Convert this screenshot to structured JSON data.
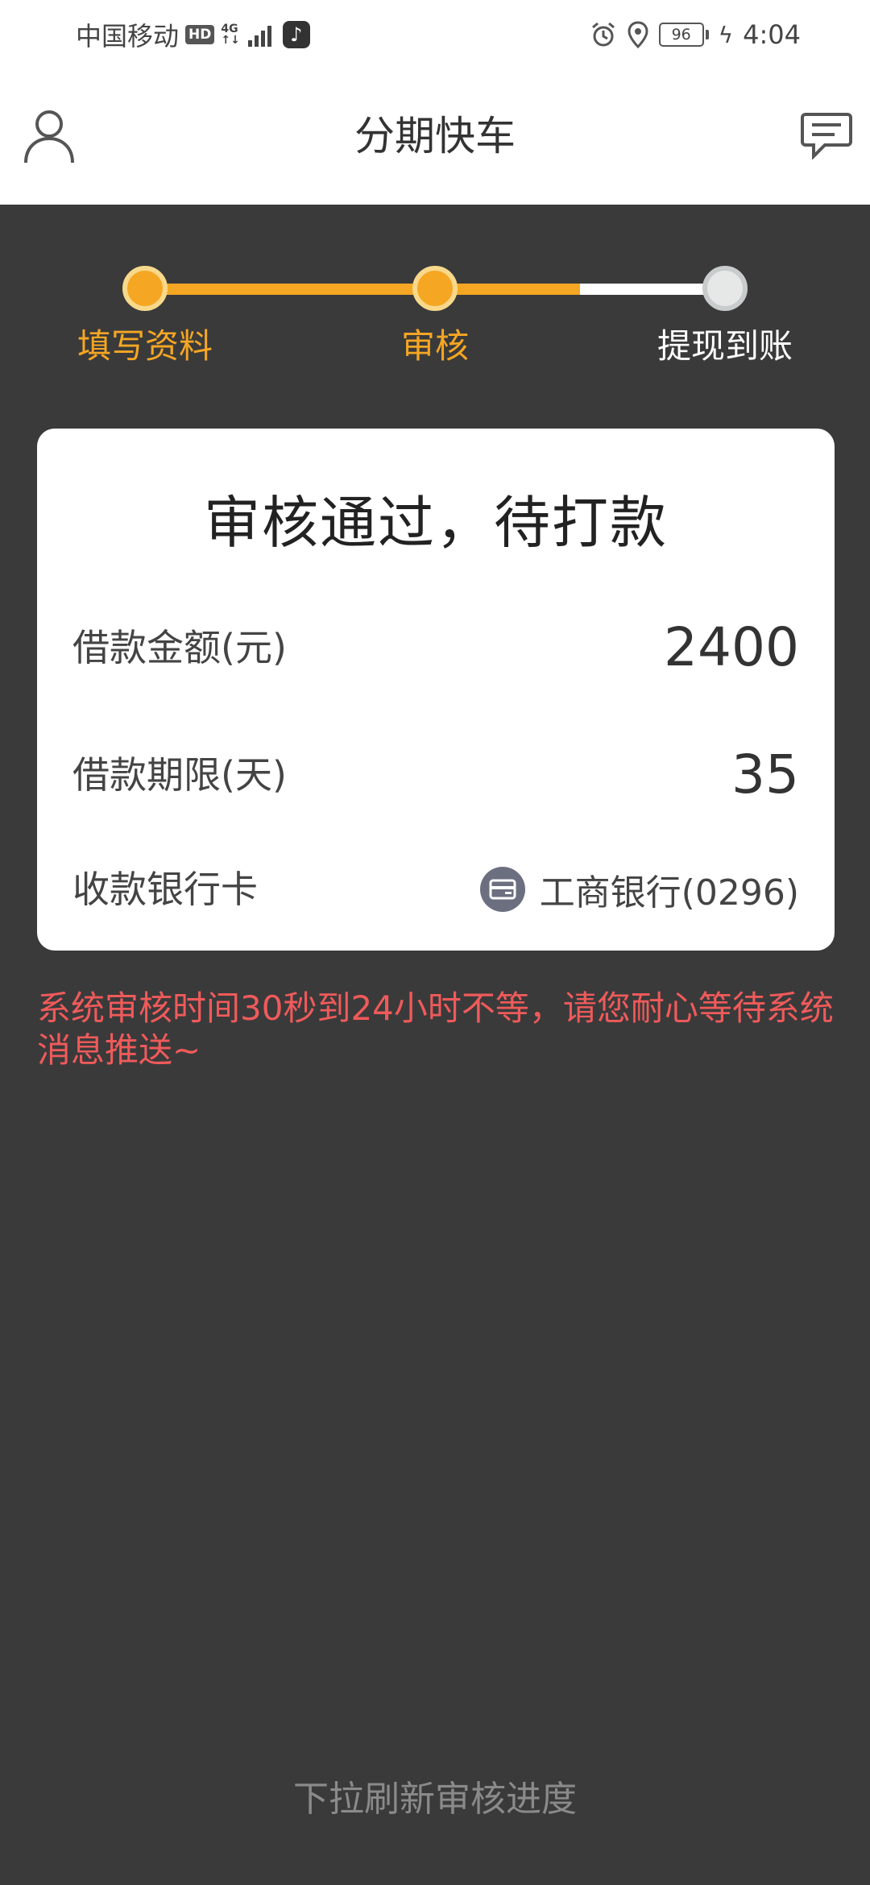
{
  "status_bar": {
    "carrier": "中国移动",
    "hd": "HD",
    "network": "4G",
    "battery": "96",
    "time": "4:04"
  },
  "header": {
    "title": "分期快车"
  },
  "progress": {
    "steps": [
      {
        "label": "填写资料",
        "state": "done"
      },
      {
        "label": "审核",
        "state": "current"
      },
      {
        "label": "提现到账",
        "state": "pending"
      }
    ],
    "colors": {
      "active": "#f5a623",
      "pending": "#ffffff"
    }
  },
  "card": {
    "status_title": "审核通过，待打款",
    "rows": [
      {
        "label": "借款金额(元)",
        "value": "2400"
      },
      {
        "label": "借款期限(天)",
        "value": "35"
      },
      {
        "label": "收款银行卡",
        "value": "工商银行(0296)"
      }
    ]
  },
  "notice": "系统审核时间30秒到24小时不等，请您耐心等待系统消息推送~",
  "footer": {
    "pull_refresh_hint": "下拉刷新审核进度"
  }
}
